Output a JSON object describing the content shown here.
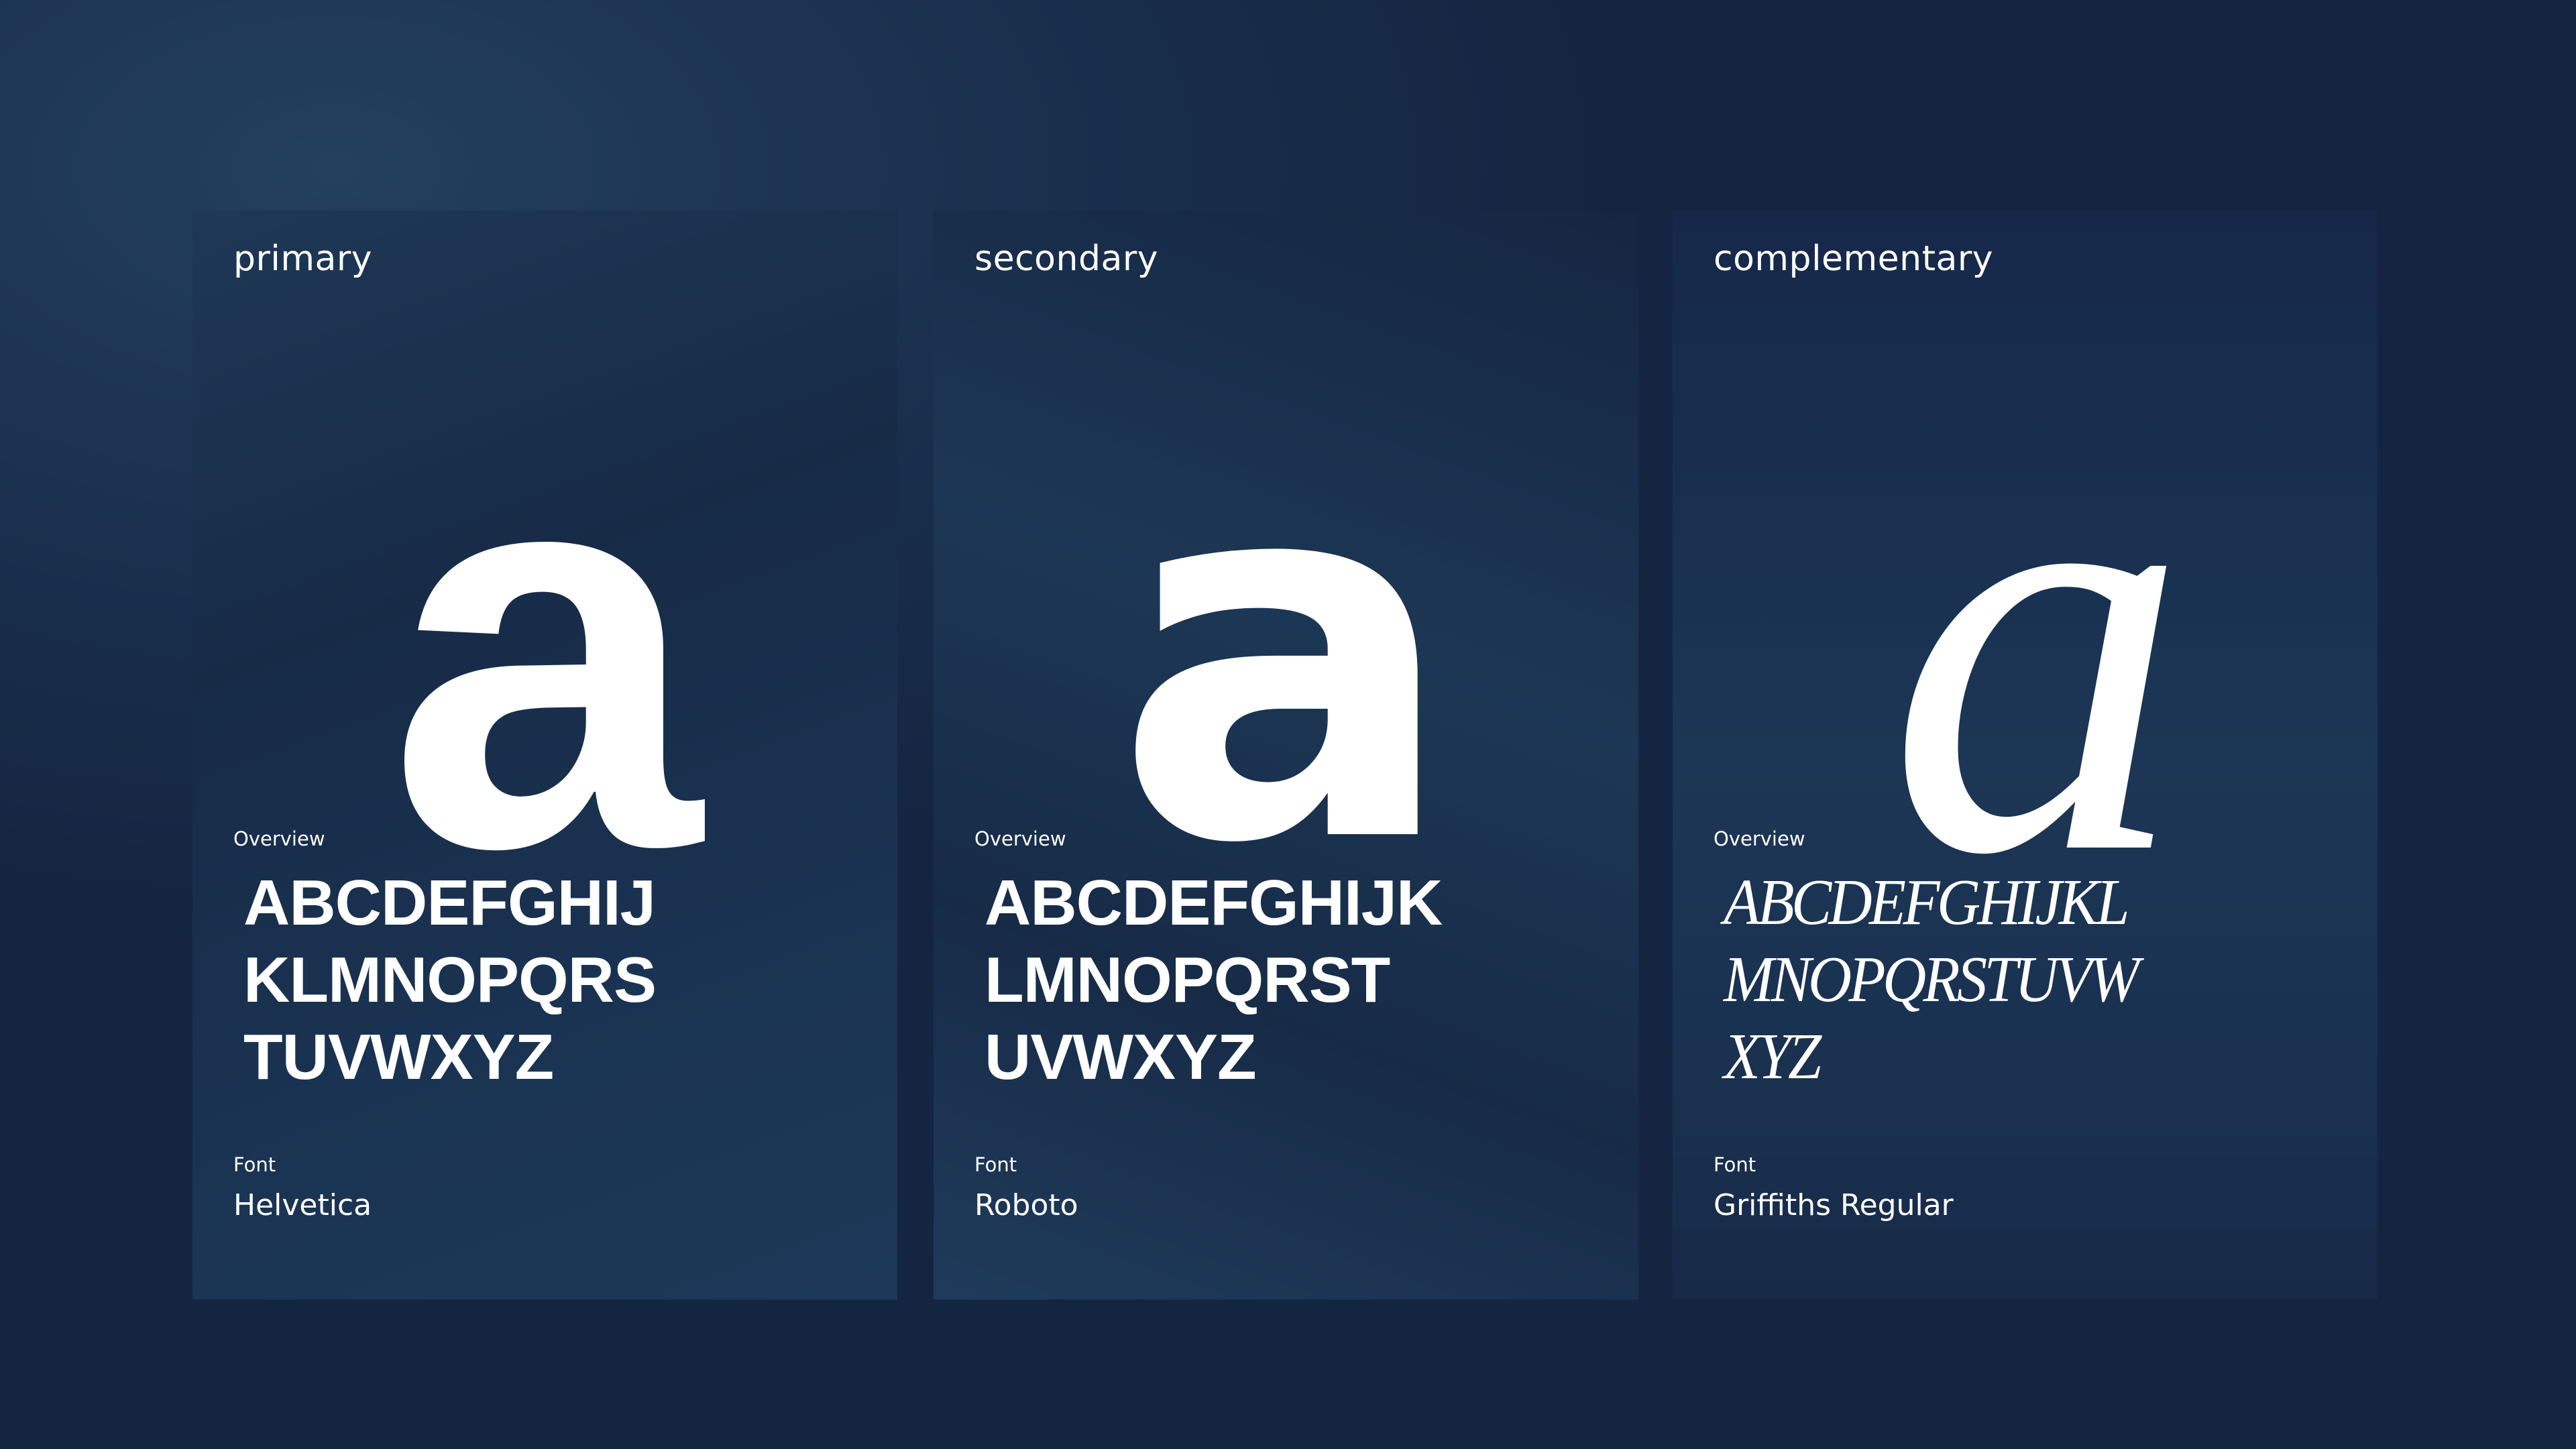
{
  "cards": [
    {
      "title": "primary",
      "glyph": "a",
      "overview_label": "Overview",
      "alphabet_lines": [
        "ABCDEFGHIJ",
        "KLMNOPQRS",
        "TUVWXYZ"
      ],
      "font_label": "Font",
      "font_name": "Helvetica"
    },
    {
      "title": "secondary",
      "glyph": "a",
      "overview_label": "Overview",
      "alphabet_lines": [
        "ABCDEFGHIJK",
        "LMNOPQRST",
        "UVWXYZ"
      ],
      "font_label": "Font",
      "font_name": "Roboto"
    },
    {
      "title": "complementary",
      "glyph": "a",
      "overview_label": "Overview",
      "alphabet_lines": [
        "ABCDEFGHIJKL",
        "MNOPQRSTUVW",
        "XYZ"
      ],
      "font_label": "Font",
      "font_name": "Griffiths Regular"
    }
  ],
  "colors": {
    "background": "#1a3150",
    "text": "#ffffff"
  }
}
